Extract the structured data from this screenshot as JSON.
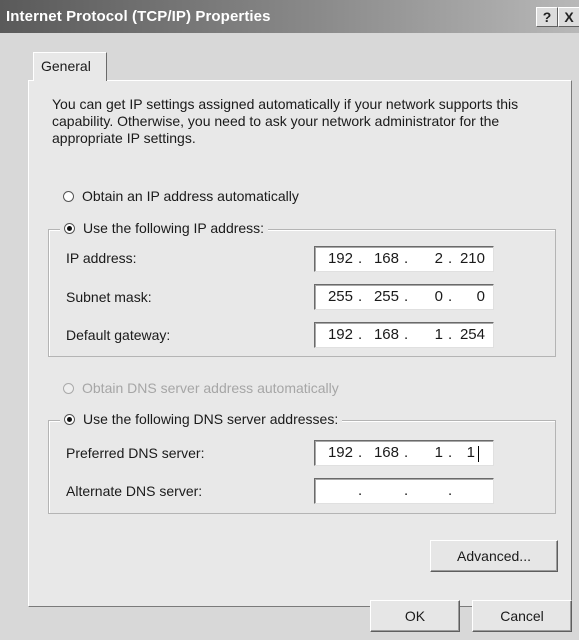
{
  "window": {
    "title": "Internet Protocol (TCP/IP) Properties",
    "help_button": "?",
    "close_button": "X"
  },
  "tabs": [
    {
      "label": "General",
      "selected": true
    }
  ],
  "intro_text": "You can get IP settings assigned automatically if your network supports this capability. Otherwise, you need to ask your network administrator for the appropriate IP settings.",
  "ip_section": {
    "auto_option": {
      "label": "Obtain an IP address automatically",
      "selected": false
    },
    "manual_option": {
      "label": "Use the following IP address:",
      "selected": true
    },
    "fields": [
      {
        "label": "IP address:",
        "octets": [
          "192",
          "168",
          "2",
          "210"
        ]
      },
      {
        "label": "Subnet mask:",
        "octets": [
          "255",
          "255",
          "0",
          "0"
        ]
      },
      {
        "label": "Default gateway:",
        "octets": [
          "192",
          "168",
          "1",
          "254"
        ]
      }
    ]
  },
  "dns_section": {
    "auto_option": {
      "label": "Obtain DNS server address automatically",
      "selected": false,
      "enabled": false
    },
    "manual_option": {
      "label": "Use the following DNS server addresses:",
      "selected": true
    },
    "fields": [
      {
        "label": "Preferred DNS server:",
        "octets": [
          "192",
          "168",
          "1",
          "1"
        ]
      },
      {
        "label": "Alternate DNS server:",
        "octets": [
          "",
          "",
          "",
          ""
        ]
      }
    ]
  },
  "buttons": {
    "advanced": "Advanced...",
    "ok": "OK",
    "cancel": "Cancel"
  }
}
